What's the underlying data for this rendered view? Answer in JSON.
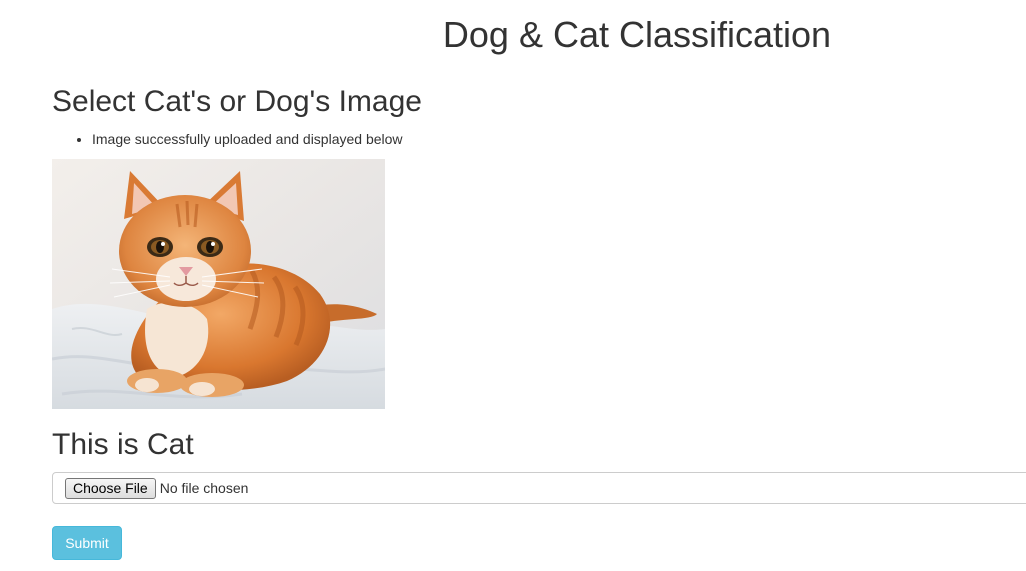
{
  "page": {
    "title": "Dog & Cat Classification"
  },
  "upload": {
    "heading": "Select Cat's or Dog's Image",
    "messages": [
      "Image successfully uploaded and displayed below"
    ],
    "image_subject": "orange tabby cat lying on white blanket"
  },
  "result": {
    "heading": "This is Cat"
  },
  "form": {
    "choose_file_label": "Choose File",
    "file_status": "No file chosen",
    "submit_label": "Submit"
  },
  "colors": {
    "text": "#333333",
    "submit_bg": "#5bc0de",
    "submit_border": "#46b8da",
    "field_border": "#cccccc"
  }
}
